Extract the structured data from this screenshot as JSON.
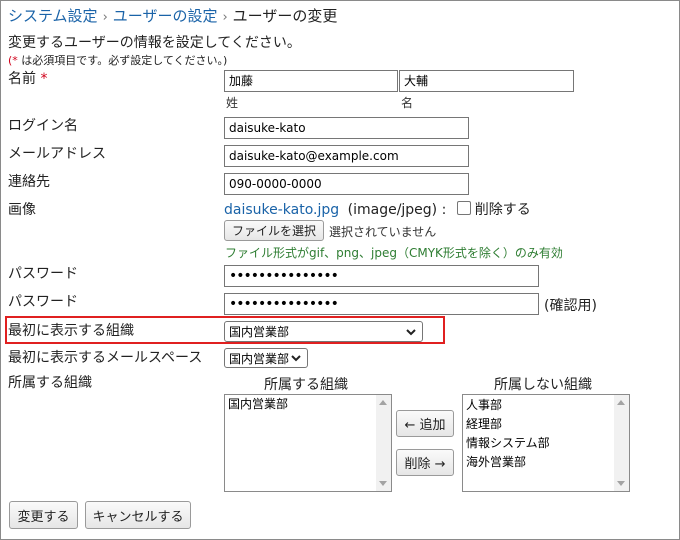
{
  "breadcrumb": {
    "items": [
      "システム設定",
      "ユーザーの設定"
    ],
    "current": "ユーザーの変更",
    "sep": "›"
  },
  "intro": "変更するユーザーの情報を設定してください。",
  "required_note": {
    "star": "(*",
    "text": " は必須項目です。必ず設定してください。)"
  },
  "fields": {
    "name": {
      "label": "名前",
      "required_mark": "*",
      "last": "加藤",
      "first": "大輔",
      "last_caption": "姓",
      "first_caption": "名"
    },
    "login": {
      "label": "ログイン名",
      "value": "daisuke-kato"
    },
    "email": {
      "label": "メールアドレス",
      "value": "daisuke-kato@example.com"
    },
    "contact": {
      "label": "連絡先",
      "value": "090-0000-0000"
    },
    "image": {
      "label": "画像",
      "file_link": "daisuke-kato.jpg",
      "file_type": "(image/jpeg) :",
      "delete_label": "削除する",
      "choose_button": "ファイルを選択",
      "no_file": "選択されていません",
      "hint": "ファイル形式がgif、png、jpeg（CMYK形式を除く）のみ有効"
    },
    "password": {
      "label": "パスワード",
      "value": "•••••••••••••••"
    },
    "password_confirm": {
      "label": "パスワード",
      "value": "•••••••••••••••",
      "suffix": "(確認用)"
    },
    "default_org": {
      "label": "最初に表示する組織",
      "selected": "国内営業部"
    },
    "default_mail": {
      "label": "最初に表示するメールスペース",
      "selected": "国内営業部"
    },
    "orgs": {
      "label": "所属する組織",
      "member_header": "所属する組織",
      "nonmember_header": "所属しない組織",
      "member_items": [
        "国内営業部"
      ],
      "nonmember_items": [
        "人事部",
        "経理部",
        "情報システム部",
        "海外営業部"
      ],
      "add_button": "← 追加",
      "remove_button": "削除 →"
    }
  },
  "actions": {
    "submit": "変更する",
    "cancel": "キャンセルする"
  },
  "colors": {
    "link": "#1a63a8",
    "required": "#d0021b",
    "hint": "#2e7d32",
    "highlight": "#e02020"
  }
}
